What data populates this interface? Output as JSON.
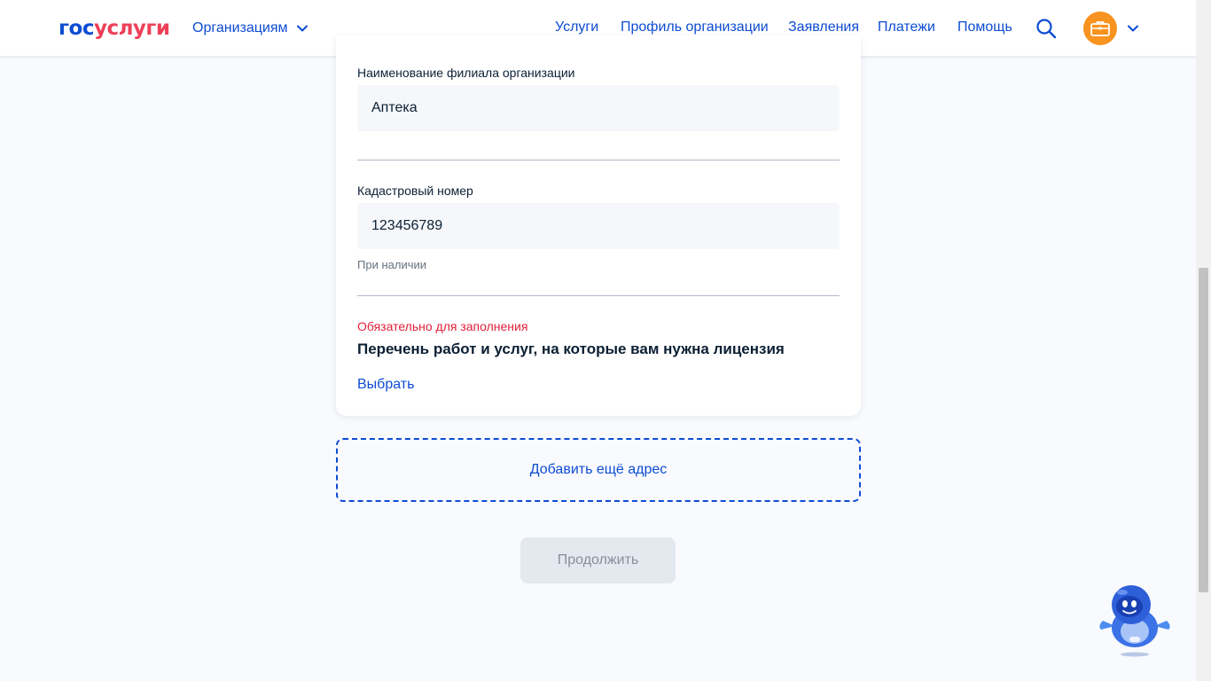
{
  "header": {
    "logo_part1": "гос",
    "logo_part2": "услуги",
    "org_switch": "Организациям",
    "nav": [
      "Услуги",
      "Профиль организации",
      "Заявления",
      "Платежи",
      "Помощь"
    ]
  },
  "form": {
    "branch_label": "Наименование филиала организации",
    "branch_value": "Аптека",
    "cadastral_label": "Кадастровый номер",
    "cadastral_value": "123456789",
    "cadastral_hint": "При наличии",
    "required_note": "Обязательно для заполнения",
    "services_title": "Перечень работ и услуг, на которые вам нужна лицензия",
    "choose_label": "Выбрать"
  },
  "add_address_label": "Добавить ещё адрес",
  "continue_label": "Продолжить",
  "colors": {
    "brand_blue": "#0d4cd3",
    "brand_red": "#ee3f58",
    "error_red": "#e1213a",
    "avatar_orange": "#f7931e"
  },
  "icons": {
    "search": "search-icon",
    "avatar": "briefcase-icon",
    "chevron": "chevron-down-icon",
    "assistant": "robot-assistant-icon"
  }
}
